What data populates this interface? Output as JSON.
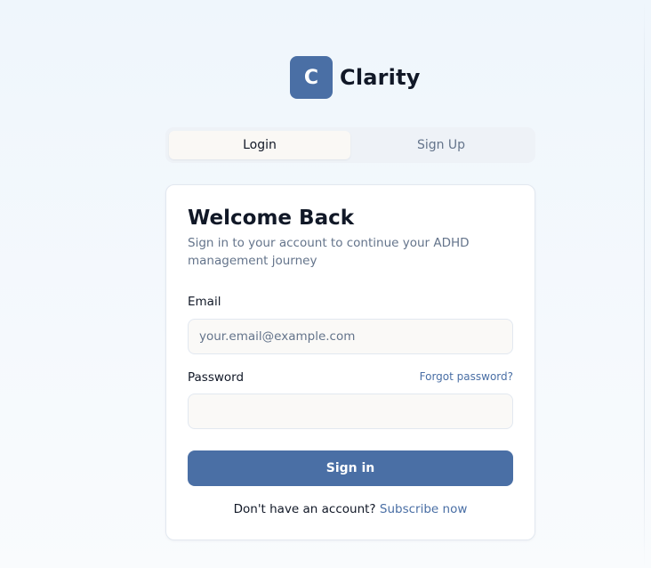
{
  "brand": {
    "logo_letter": "C",
    "name": "Clarity",
    "icon": "clarity-logo-icon"
  },
  "tabs": [
    {
      "label": "Login",
      "active": true
    },
    {
      "label": "Sign Up",
      "active": false
    }
  ],
  "card": {
    "title": "Welcome Back",
    "subtitle": "Sign in to your account to continue your ADHD management journey",
    "email": {
      "label": "Email",
      "placeholder": "your.email@example.com",
      "value": ""
    },
    "password": {
      "label": "Password",
      "forgot_label": "Forgot password?",
      "value": ""
    },
    "submit_label": "Sign in",
    "footer_text": "Don't have an account?",
    "footer_link": "Subscribe now"
  },
  "colors": {
    "accent": "#4a6fa5",
    "title_text": "#111827",
    "muted_text": "#64748b",
    "background": "#eff6fc"
  }
}
